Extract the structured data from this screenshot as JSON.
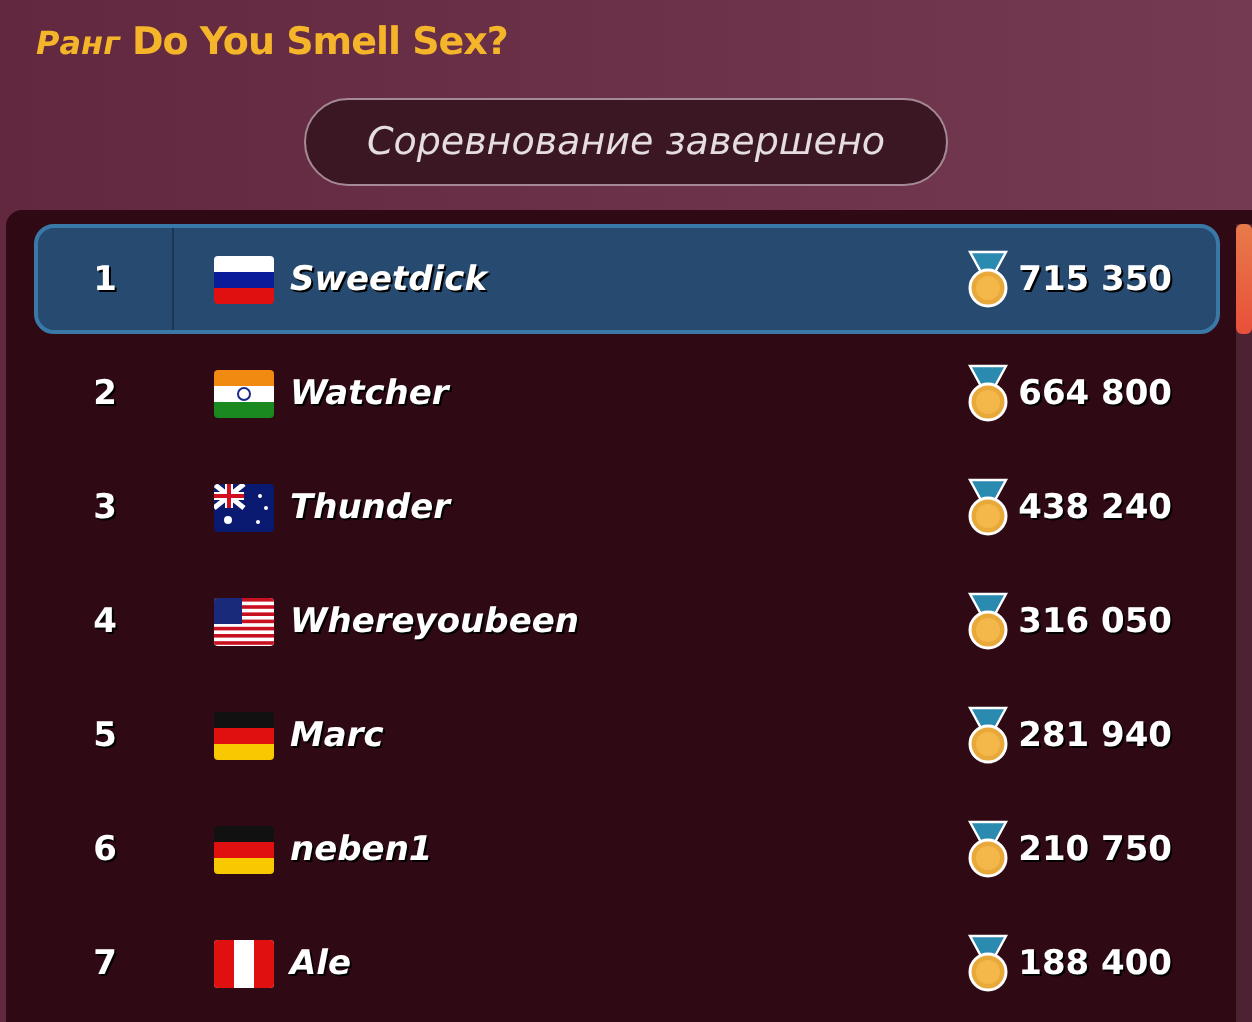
{
  "header": {
    "label": "Ранг",
    "title": "Do You Smell Sex?"
  },
  "status_button": "Соревнование завершено",
  "leaderboard": [
    {
      "rank": "1",
      "kind": "ru",
      "name": "Sweetdick",
      "score": "715 350",
      "selected": true
    },
    {
      "rank": "2",
      "kind": "in",
      "name": "Watcher",
      "score": "664 800",
      "selected": false
    },
    {
      "rank": "3",
      "kind": "au",
      "name": "Thunder",
      "score": "438 240",
      "selected": false
    },
    {
      "rank": "4",
      "kind": "us",
      "name": "Whereyoubeen",
      "score": "316 050",
      "selected": false
    },
    {
      "rank": "5",
      "kind": "de",
      "name": "Marc",
      "score": "281 940",
      "selected": false
    },
    {
      "rank": "6",
      "kind": "de",
      "name": "neben1",
      "score": "210 750",
      "selected": false
    },
    {
      "rank": "7",
      "kind": "pe",
      "name": "Ale",
      "score": "188 400",
      "selected": false
    }
  ]
}
